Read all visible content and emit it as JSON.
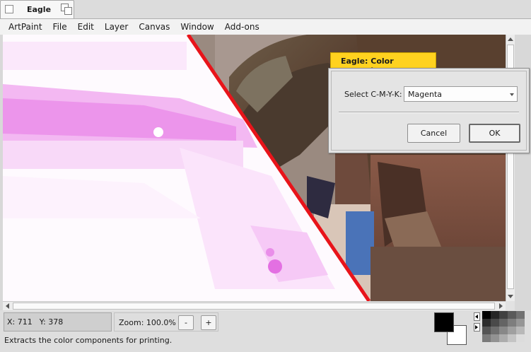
{
  "window": {
    "title": "Eagle"
  },
  "menu": [
    "ArtPaint",
    "File",
    "Edit",
    "Layer",
    "Canvas",
    "Window",
    "Add-ons"
  ],
  "status": {
    "x_label": "X: 711",
    "y_label": "Y: 378",
    "zoom_label": "Zoom: 100.0%",
    "zoom_out": "-",
    "zoom_in": "+",
    "message": "Extracts the color components for printing."
  },
  "dialog": {
    "title": "Eagle: Color separator",
    "select_label": "Select C-M-Y-K:",
    "selected_value": "Magenta",
    "cancel_label": "Cancel",
    "ok_label": "OK"
  },
  "colors": {
    "foreground": "#000000",
    "background": "#ffffff",
    "accent_tab": "#ffd21f",
    "divider_line": "#e8141a",
    "magenta_channel": "#f0a0ef"
  }
}
